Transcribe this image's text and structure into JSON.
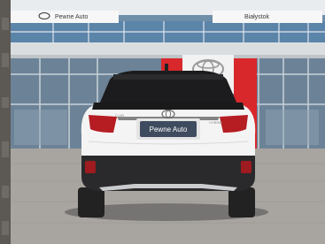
{
  "photo": {
    "dealer_sign_left": "Pewne Auto",
    "dealer_sign_right": "Białystok",
    "license_plate": "Pewne Auto",
    "brand_logo": "toyota-logo-icon",
    "colors": {
      "car_body": "#f4f4f4",
      "building_glass": "#5f87a8",
      "brand_red": "#d8282c",
      "pavement": "#a8a4a0"
    }
  }
}
